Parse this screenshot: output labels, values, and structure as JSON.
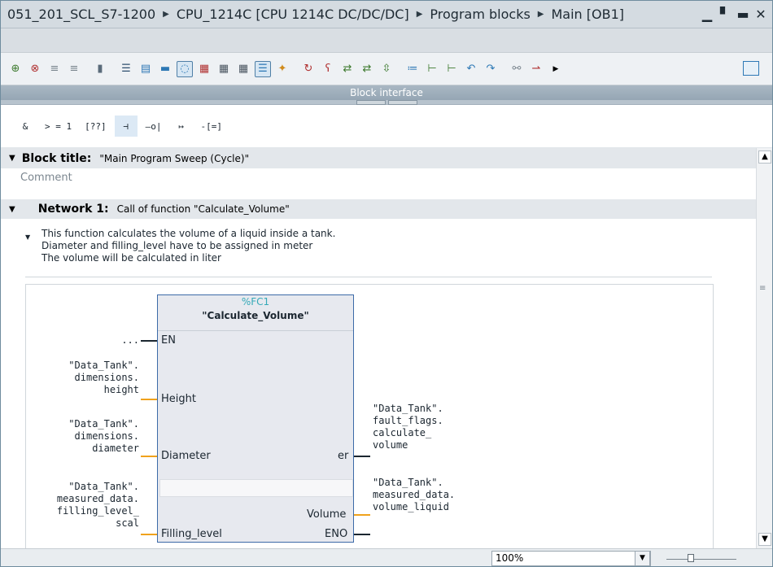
{
  "window": {
    "breadcrumb": [
      "051_201_SCL_S7-1200",
      "CPU_1214C [CPU 1214C DC/DC/DC]",
      "Program blocks",
      "Main [OB1]"
    ],
    "controls": [
      "minimize-icon",
      "float-icon",
      "maximize-icon",
      "close-icon"
    ]
  },
  "toolbar": {
    "icons": [
      "insert-network-icon",
      "delete-network-icon",
      "insert-row-icon",
      "append-row-icon",
      "reset-start-values-icon",
      "absolute-relative-icon",
      "open-networks-icon",
      "close-networks-icon",
      "network-comments-icon",
      "favorites-icon",
      "breakpoint-icon",
      "call-hierarchy-icon",
      "jump-next-error-icon",
      "monitor-icon",
      "reset-icon",
      "modify-icon",
      "go-to-icon",
      "update-icon",
      "jump-icon",
      "list-icon",
      "rung-icon",
      "compare-icon",
      "reload-icon",
      "share-icon",
      "show-more-icon",
      "layout-icon"
    ]
  },
  "block_interface": {
    "label": "Block interface"
  },
  "lad_elements": [
    "&",
    "> = 1",
    "[??]",
    "⊣",
    "—o|",
    "↦",
    "-[=]"
  ],
  "block": {
    "title_label": "Block title:",
    "title_value": "\"Main Program Sweep (Cycle)\"",
    "comment_placeholder": "Comment"
  },
  "network": {
    "label": "Network 1:",
    "title": "Call of function \"Calculate_Volume\"",
    "comment": [
      "This function calculates the volume of a liquid inside a tank.",
      "Diameter and filling_level have to be assigned in meter",
      "The volume will be calculated in liter"
    ]
  },
  "fb": {
    "number": "%FC1",
    "name": "\"Calculate_Volume\"",
    "pins": {
      "en": "EN",
      "height": "Height",
      "diameter": "Diameter",
      "filling": "Filling_level",
      "er": "er",
      "volume": "Volume",
      "eno": "ENO"
    },
    "operands": {
      "en": "...",
      "height": [
        "\"Data_Tank\".",
        "dimensions.",
        "height"
      ],
      "diameter": [
        "\"Data_Tank\".",
        "dimensions.",
        "diameter"
      ],
      "filling": [
        "\"Data_Tank\".",
        "measured_data.",
        "filling_level_",
        "scal"
      ],
      "er": [
        "\"Data_Tank\".",
        "fault_flags.",
        "calculate_",
        "volume"
      ],
      "volume": [
        "\"Data_Tank\".",
        "measured_data.",
        "volume_liquid"
      ]
    },
    "wire_colors": {
      "bool": "#1b2630",
      "value": "#f0a21c"
    }
  },
  "status": {
    "zoom": "100%"
  }
}
